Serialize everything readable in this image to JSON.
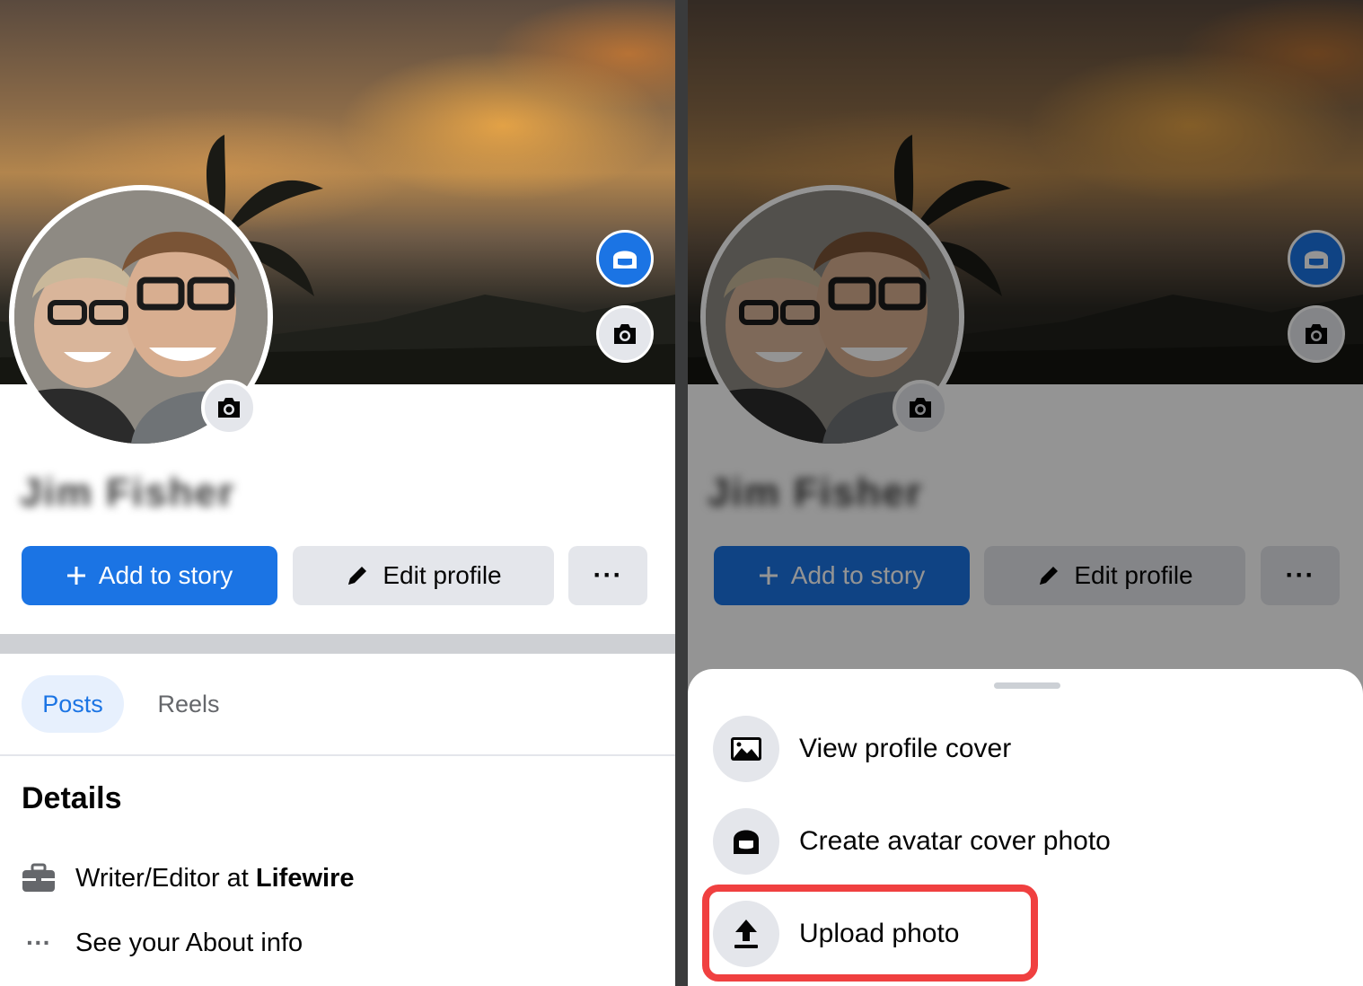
{
  "profile": {
    "name": "Jim Fisher",
    "add_to_story": "Add to story",
    "edit_profile": "Edit profile",
    "more_label": "···"
  },
  "tabs": [
    {
      "label": "Posts",
      "active": true
    },
    {
      "label": "Reels",
      "active": false
    }
  ],
  "details": {
    "title": "Details",
    "work_prefix": "Writer/Editor at ",
    "work_company": "Lifewire",
    "about": "See your About info",
    "about_icon_label": "···"
  },
  "sheet": {
    "items": [
      {
        "label": "View profile cover",
        "icon": "image-icon"
      },
      {
        "label": "Create avatar cover photo",
        "icon": "avatar-icon"
      },
      {
        "label": "Upload photo",
        "icon": "upload-icon",
        "highlighted": true
      }
    ]
  },
  "colors": {
    "primary": "#1b74e4",
    "secondary_button": "#e4e6eb",
    "highlight": "#f04040",
    "tab_active_bg": "#e7f0fd"
  }
}
